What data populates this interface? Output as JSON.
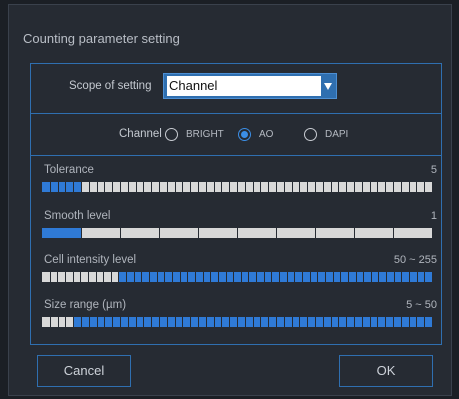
{
  "dialog": {
    "title": "Counting parameter setting"
  },
  "scope": {
    "label": "Scope of setting",
    "value": "Channel"
  },
  "channel": {
    "label": "Channel",
    "options": [
      "BRIGHT",
      "AO",
      "DAPI"
    ],
    "selected": "AO"
  },
  "sliders": [
    {
      "name": "tolerance",
      "label": "Tolerance",
      "value_text": "5",
      "segments": 50,
      "fill_start": 0.0,
      "fill_end": 0.1
    },
    {
      "name": "smooth-level",
      "label": "Smooth level",
      "value_text": "1",
      "segments": 10,
      "fill_start": 0.0,
      "fill_end": 0.1
    },
    {
      "name": "cell-intensity-level",
      "label": "Cell intensity level",
      "value_text": "50 ~ 255",
      "segments": 51,
      "fill_start": 0.196,
      "fill_end": 1.0
    },
    {
      "name": "size-range",
      "label": "Size range (µm)",
      "value_text": "5 ~ 50",
      "segments": 50,
      "fill_start": 0.08,
      "fill_end": 1.0
    }
  ],
  "buttons": {
    "cancel": "Cancel",
    "ok": "OK"
  },
  "colors": {
    "accent": "#2f7ad6",
    "border": "#2f6fb0",
    "background": "#262b33"
  }
}
